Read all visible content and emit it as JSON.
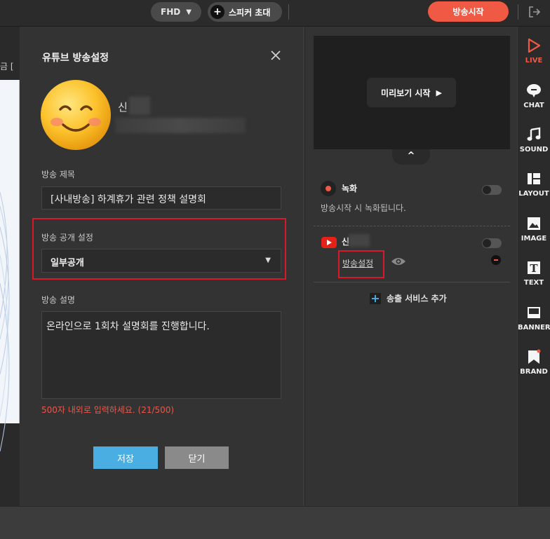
{
  "topbar": {
    "resolution": "FHD",
    "invite_label": "스피커 초대",
    "start_label": "방송시작"
  },
  "canvas": {
    "partial_label": "금 ["
  },
  "modal": {
    "title": "유튜브 방송설정",
    "user_name": "신",
    "title_label": "방송 제목",
    "title_value": "[사내방송] 하계휴가 관련 정책 설명회",
    "privacy_label": "방송 공개 설정",
    "privacy_value": "일부공개",
    "desc_label": "방송 설명",
    "desc_value": "온라인으로 1회차 설명회를 진행합니다.",
    "hint": "500자 내외로 입력하세요. (21/500)",
    "save_label": "저장",
    "close_label": "닫기"
  },
  "panel": {
    "preview_label": "미리보기 시작",
    "recording_title": "녹화",
    "recording_desc": "방송시작 시 녹화됩니다.",
    "youtube_name": "신",
    "settings_link": "방송설정",
    "add_service": "송출 서비스 추가"
  },
  "toolbar": {
    "items": [
      {
        "label": "LIVE",
        "icon": "live-icon"
      },
      {
        "label": "CHAT",
        "icon": "chat-icon"
      },
      {
        "label": "SOUND",
        "icon": "sound-icon"
      },
      {
        "label": "LAYOUT",
        "icon": "layout-icon"
      },
      {
        "label": "IMAGE",
        "icon": "image-icon"
      },
      {
        "label": "TEXT",
        "icon": "text-icon"
      },
      {
        "label": "BANNER",
        "icon": "banner-icon"
      },
      {
        "label": "BRAND",
        "icon": "brand-icon"
      }
    ]
  },
  "colors": {
    "accent": "#f05a44",
    "primary_button": "#4aaee3",
    "highlight_box": "#d7192a"
  }
}
